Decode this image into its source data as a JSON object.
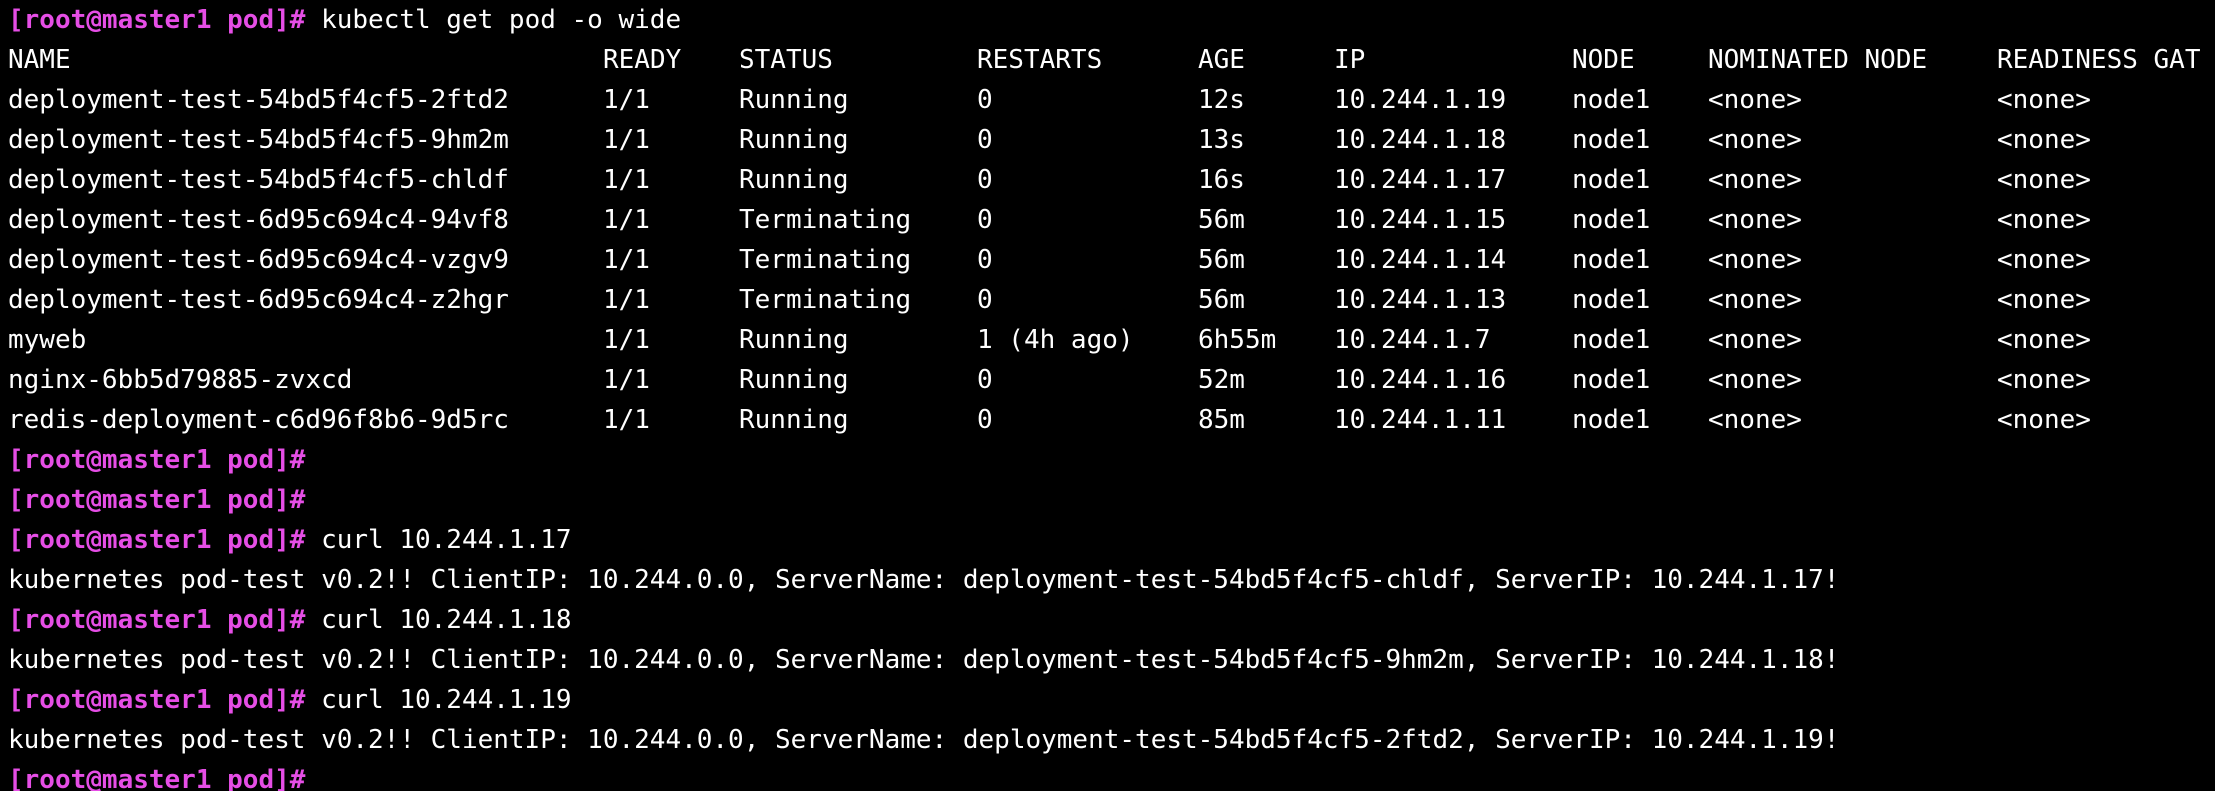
{
  "terminal": {
    "prompt": "[root@master1 pod]#",
    "command1": " kubectl get pod -o wide",
    "headers": {
      "name": "NAME",
      "ready": "READY",
      "status": "STATUS",
      "restarts": "RESTARTS",
      "age": "AGE",
      "ip": "IP",
      "node": "NODE",
      "nominated": "NOMINATED NODE",
      "readiness": "READINESS GAT"
    },
    "rows": [
      {
        "name": "deployment-test-54bd5f4cf5-2ftd2",
        "ready": "1/1",
        "status": "Running",
        "restarts": "0",
        "age": "12s",
        "ip": "10.244.1.19",
        "node": "node1",
        "nominated": "<none>",
        "readiness": "<none>"
      },
      {
        "name": "deployment-test-54bd5f4cf5-9hm2m",
        "ready": "1/1",
        "status": "Running",
        "restarts": "0",
        "age": "13s",
        "ip": "10.244.1.18",
        "node": "node1",
        "nominated": "<none>",
        "readiness": "<none>"
      },
      {
        "name": "deployment-test-54bd5f4cf5-chldf",
        "ready": "1/1",
        "status": "Running",
        "restarts": "0",
        "age": "16s",
        "ip": "10.244.1.17",
        "node": "node1",
        "nominated": "<none>",
        "readiness": "<none>"
      },
      {
        "name": "deployment-test-6d95c694c4-94vf8",
        "ready": "1/1",
        "status": "Terminating",
        "restarts": "0",
        "age": "56m",
        "ip": "10.244.1.15",
        "node": "node1",
        "nominated": "<none>",
        "readiness": "<none>"
      },
      {
        "name": "deployment-test-6d95c694c4-vzgv9",
        "ready": "1/1",
        "status": "Terminating",
        "restarts": "0",
        "age": "56m",
        "ip": "10.244.1.14",
        "node": "node1",
        "nominated": "<none>",
        "readiness": "<none>"
      },
      {
        "name": "deployment-test-6d95c694c4-z2hgr",
        "ready": "1/1",
        "status": "Terminating",
        "restarts": "0",
        "age": "56m",
        "ip": "10.244.1.13",
        "node": "node1",
        "nominated": "<none>",
        "readiness": "<none>"
      },
      {
        "name": "myweb",
        "ready": "1/1",
        "status": "Running",
        "restarts": "1 (4h ago)",
        "age": "6h55m",
        "ip": "10.244.1.7",
        "node": "node1",
        "nominated": "<none>",
        "readiness": "<none>"
      },
      {
        "name": "nginx-6bb5d79885-zvxcd",
        "ready": "1/1",
        "status": "Running",
        "restarts": "0",
        "age": "52m",
        "ip": "10.244.1.16",
        "node": "node1",
        "nominated": "<none>",
        "readiness": "<none>"
      },
      {
        "name": "redis-deployment-c6d96f8b6-9d5rc",
        "ready": "1/1",
        "status": "Running",
        "restarts": "0",
        "age": "85m",
        "ip": "10.244.1.11",
        "node": "node1",
        "nominated": "<none>",
        "readiness": "<none>"
      }
    ],
    "curl1_cmd": " curl 10.244.1.17",
    "curl1_out": "kubernetes pod-test v0.2!! ClientIP: 10.244.0.0, ServerName: deployment-test-54bd5f4cf5-chldf, ServerIP: 10.244.1.17!",
    "curl2_cmd": " curl 10.244.1.18",
    "curl2_out": "kubernetes pod-test v0.2!! ClientIP: 10.244.0.0, ServerName: deployment-test-54bd5f4cf5-9hm2m, ServerIP: 10.244.1.18!",
    "curl3_cmd": " curl 10.244.1.19",
    "curl3_out": "kubernetes pod-test v0.2!! ClientIP: 10.244.0.0, ServerName: deployment-test-54bd5f4cf5-2ftd2, ServerIP: 10.244.1.19!"
  },
  "colors": {
    "background": "#000000",
    "text": "#ffffff",
    "prompt": "#e64ee6"
  }
}
